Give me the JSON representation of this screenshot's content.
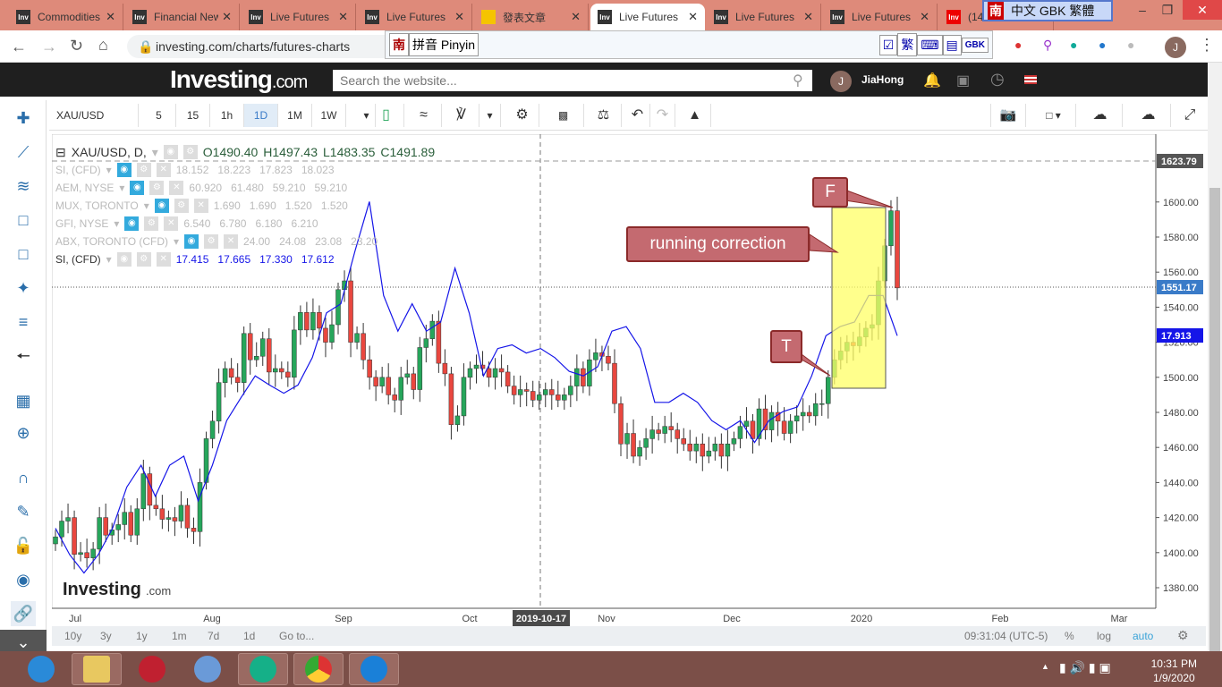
{
  "browser": {
    "tabs": [
      {
        "label": "Commodities"
      },
      {
        "label": "Financial News"
      },
      {
        "label": "Live Futures"
      },
      {
        "label": "Live Futures"
      },
      {
        "label": "發表文章"
      },
      {
        "label": "Live Futures"
      },
      {
        "label": "Live Futures"
      },
      {
        "label": "Live Futures"
      },
      {
        "label": "(14"
      }
    ],
    "active_tab": 5,
    "url": "investing.com/charts/futures-charts",
    "ime_bar": "中文 GBK 繁體",
    "ime_nan": "南",
    "pinyin_label": "拼音 Pinyin",
    "pinyin_trad": "繁",
    "pinyin_gbk": "GBK",
    "profile": "J"
  },
  "site": {
    "logo": "Investing",
    "logo_suffix": ".com",
    "search_placeholder": "Search the website...",
    "user_initial": "J",
    "user": "JiaHong"
  },
  "toolbar": {
    "symbol": "XAU/USD",
    "intervals": [
      "5",
      "15",
      "1h",
      "1D",
      "1M",
      "1W"
    ],
    "active_interval": "1D"
  },
  "legend": {
    "main": {
      "name": "XAU/USD, D,",
      "o": "O1490.40",
      "h": "H1497.43",
      "l": "L1483.35",
      "c": "C1491.89"
    },
    "overlays": [
      {
        "name": "SI, (CFD)",
        "values": "18.152   18.223   17.823   18.023",
        "visible": true
      },
      {
        "name": "AEM, NYSE",
        "values": "60.920   61.480   59.210   59.210",
        "visible": true
      },
      {
        "name": "MUX, TORONTO",
        "values": "1.690   1.690   1.520   1.520",
        "visible": true
      },
      {
        "name": "GFI, NYSE",
        "values": "6.540   6.780   6.180   6.210",
        "visible": true
      },
      {
        "name": "ABX, TORONTO (CFD)",
        "values": "24.00   24.08   23.08   23.20",
        "visible": true
      },
      {
        "name": "SI, (CFD)",
        "values": "17.415   17.665   17.330   17.612",
        "visible": false
      }
    ]
  },
  "chart_data": {
    "type": "candlestick",
    "title": "XAU/USD, D",
    "y_ticks": [
      1380,
      1400,
      1420,
      1440,
      1460,
      1480,
      1500,
      1520,
      1540,
      1560,
      1580,
      1600
    ],
    "ylim": [
      1368,
      1636
    ],
    "x_ticks": [
      "Jul",
      "Aug",
      "Sep",
      "Oct",
      "Nov",
      "Dec",
      "2020",
      "Feb",
      "Mar"
    ],
    "crosshair_date": "2019-10-17",
    "price_labels": {
      "high_line": "1623.79",
      "last_price": "1551.17",
      "si_last": "17.913"
    },
    "colors": {
      "up": "#26a65b",
      "down": "#e9473f",
      "si": "#1515e8"
    },
    "closes": [
      1409,
      1418,
      1420,
      1399,
      1400,
      1397,
      1402,
      1420,
      1410,
      1413,
      1416,
      1423,
      1410,
      1425,
      1445,
      1427,
      1425,
      1419,
      1420,
      1418,
      1427,
      1414,
      1412,
      1440,
      1465,
      1475,
      1497,
      1505,
      1500,
      1497,
      1525,
      1510,
      1512,
      1522,
      1503,
      1505,
      1503,
      1500,
      1527,
      1537,
      1527,
      1537,
      1528,
      1520,
      1530,
      1550,
      1555,
      1520,
      1525,
      1510,
      1500,
      1495,
      1500,
      1490,
      1487,
      1500,
      1502,
      1493,
      1517,
      1522,
      1532,
      1508,
      1502,
      1473,
      1478,
      1500,
      1505,
      1507,
      1505,
      1500,
      1505,
      1503,
      1495,
      1490,
      1493,
      1492,
      1487,
      1490,
      1493,
      1490,
      1487,
      1490,
      1495,
      1505,
      1495,
      1510,
      1514,
      1512,
      1508,
      1485,
      1462,
      1468,
      1455,
      1460,
      1465,
      1470,
      1468,
      1472,
      1470,
      1465,
      1462,
      1458,
      1462,
      1455,
      1458,
      1462,
      1455,
      1462,
      1465,
      1472,
      1475,
      1465,
      1482,
      1470,
      1480,
      1475,
      1468,
      1475,
      1478,
      1480,
      1478,
      1485,
      1485,
      1500,
      1510,
      1515,
      1520,
      1518,
      1523,
      1528,
      1530,
      1555,
      1575,
      1595,
      1551
    ],
    "si_series": [
      15.8,
      15.51,
      15.31,
      15.51,
      15.8,
      16.25,
      16.49,
      16.15,
      16.49,
      16.59,
      16.1,
      16.49,
      16.98,
      17.23,
      17.47,
      17.37,
      17.28,
      17.37,
      17.67,
      18.16,
      18.26,
      18.84,
      19.38,
      18.35,
      17.96,
      18.26,
      17.96,
      18.06,
      18.65,
      18.16,
      17.47,
      17.77,
      17.81,
      17.72,
      17.77,
      17.67,
      17.52,
      17.47,
      17.57,
      17.96,
      18.01,
      17.77,
      17.18,
      17.18,
      17.28,
      17.18,
      16.98,
      16.88,
      16.98,
      16.74,
      16.98,
      17.08,
      17.13,
      17.47,
      17.91,
      18.01,
      18.06,
      18.35,
      18.35,
      17.91
    ],
    "annotations": [
      "F",
      "running correction",
      "T"
    ],
    "watermark": "Investing.com"
  },
  "bottom": {
    "ranges": [
      "10y",
      "3y",
      "1y",
      "1m",
      "7d",
      "1d",
      "Go to..."
    ],
    "time": "09:31:04 (UTC-5)",
    "pct": "%",
    "log": "log",
    "auto": "auto"
  },
  "taskbar": {
    "time": "10:31 PM",
    "date": "1/9/2020"
  }
}
